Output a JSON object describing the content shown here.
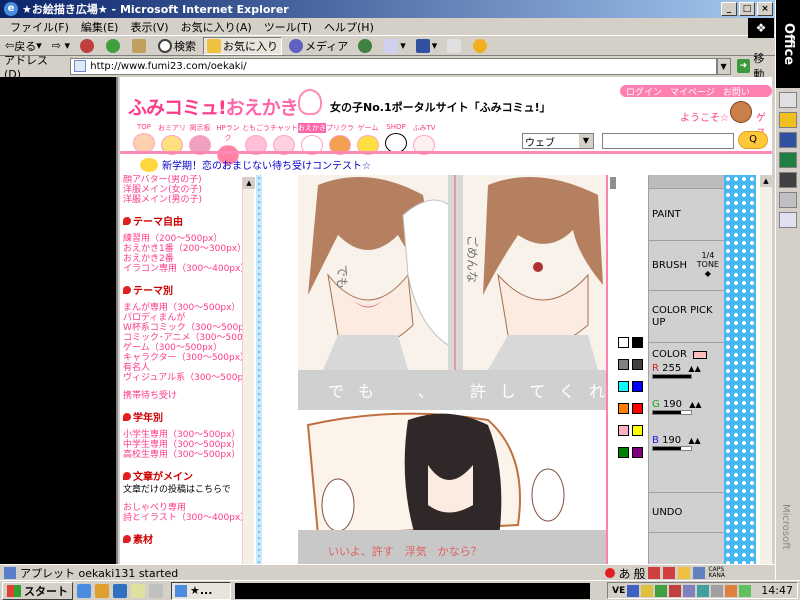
{
  "window": {
    "title": "★お絵描き広場★ - Microsoft Internet Explorer",
    "min_label": "_",
    "max_label": "□",
    "close_label": "×"
  },
  "menubar": [
    "ファイル(F)",
    "編集(E)",
    "表示(V)",
    "お気に入り(A)",
    "ツール(T)",
    "ヘルプ(H)"
  ],
  "toolbar": {
    "back": "戻る",
    "search": "検索",
    "favorites": "お気に入り",
    "media": "メディア"
  },
  "address": {
    "label": "アドレス(D)",
    "url": "http://www.fumi23.com/oekaki/",
    "go": "移動"
  },
  "site": {
    "logo_main": "ふみコミュ!",
    "logo_oe": "おえかき",
    "tagline": "女の子No.1ポータルサイト「ふみコミュ!」",
    "pill_links": [
      "ログイン",
      "マイページ",
      "お問い"
    ],
    "welcome": "ようこそ☆",
    "welcome_name": "ゲス",
    "nav": [
      "TOP",
      "おミアリ",
      "掲示板",
      "HPランク",
      "ともごう",
      "チャット",
      "おえかき",
      "プリクラ",
      "ゲーム",
      "SHOP",
      "ふみTV"
    ],
    "search_select": "ウェブ",
    "news": "新学期！恋のおまじない待ち受けコンテスト☆"
  },
  "sidebar": {
    "top_links": [
      "顔アバター(男の子)",
      "洋服メイン(女の子)",
      "洋服メイン(男の子)"
    ],
    "sections": [
      {
        "title": "テーマ自由",
        "links": [
          "練習用（200〜500px）",
          "おえかき1番（200〜300px）",
          "おえかき2番",
          "イラコン専用（300〜400px）"
        ]
      },
      {
        "title": "テーマ別",
        "links": [
          "まんが専用（300〜500px）",
          "パロディまんが",
          "W杯系コミック（300〜500px）",
          "コミック･アニメ（300〜500px）",
          "ゲーム（300〜500px）",
          "キャラクター（300〜500px）",
          "有名人",
          "ヴィジュアル系（300〜500px）",
          "",
          "携帯待ち受け"
        ]
      },
      {
        "title": "学年別",
        "links": [
          "小学生専用（300〜500px）",
          "中学生専用（300〜500px）",
          "高校生専用（300〜500px）"
        ]
      },
      {
        "title": "文章がメイン",
        "subtitle": "文章だけの投稿はこちらで",
        "links": [
          "",
          "おしゃべり専用",
          "詩とイラスト（300〜400px）"
        ]
      },
      {
        "title": "素材",
        "links": []
      }
    ]
  },
  "canvas": {
    "text_top_left": "でも",
    "text_top_right": "ごめんな",
    "text_band": "でも　、　許してくれ",
    "text_bottom": "いいよ、許す　浮気　かなら？"
  },
  "palette": {
    "swatches": [
      "#ffffff",
      "#000000",
      "#808080",
      "#404040",
      "#00ffff",
      "#0000ff",
      "#ff8000",
      "#ff0000",
      "#ffb0c0",
      "#ffff00",
      "#008000",
      "#800080"
    ]
  },
  "tools": {
    "paint": "PAINT",
    "brush": "BRUSH",
    "brush_size": "1/4",
    "brush_tone": "TONE",
    "color_pick": "COLOR PICK UP",
    "color": "COLOR",
    "r_label": "R",
    "r_value": "255",
    "g_label": "G",
    "g_value": "190",
    "b_label": "B",
    "b_value": "190",
    "undo": "UNDO"
  },
  "status": {
    "text": "アプレット oekaki131 started"
  },
  "ime": {
    "a": "あ",
    "han": "般",
    "caps": "CAPS",
    "kana": "KANA"
  },
  "taskbar": {
    "start": "スタート",
    "task": "★...",
    "clock": "14:47"
  },
  "office": {
    "label": "Office",
    "ms": "Microsoft"
  },
  "colors": {
    "brand_pink": "#ff3a8a",
    "accent_blue": "#49b8f2",
    "current_color": "#ffbebe"
  }
}
